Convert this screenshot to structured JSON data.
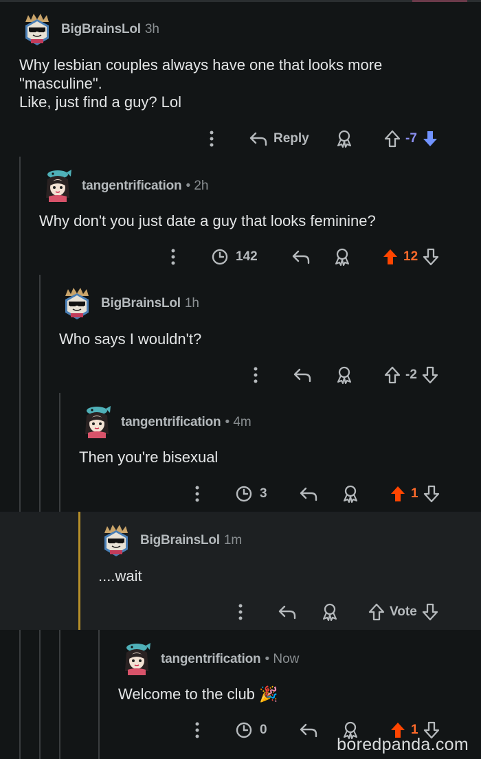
{
  "comments": [
    {
      "author": "BigBrainsLol",
      "time": "3h",
      "text": "Why lesbian couples always have one that looks more\n\"masculine\".\nLike, just find a guy? Lol",
      "reply_label": "Reply",
      "score": "-7",
      "vote": "down",
      "avatar": "sunglasses-avatar"
    },
    {
      "author": "tangentrification",
      "time": "• 2h",
      "text": "Why don't you just date a guy that looks feminine?",
      "awards": "142",
      "score": "12",
      "vote": "up",
      "avatar": "fish-hat-avatar"
    },
    {
      "author": "BigBrainsLol",
      "time": "1h",
      "text": "Who says I wouldn't?",
      "score": "-2",
      "vote": "none",
      "avatar": "sunglasses-avatar"
    },
    {
      "author": "tangentrification",
      "time": "• 4m",
      "text": "Then you're bisexual",
      "awards": "3",
      "score": "1",
      "vote": "up",
      "avatar": "fish-hat-avatar"
    },
    {
      "author": "BigBrainsLol",
      "time": "1m",
      "text": "....wait",
      "score": "Vote",
      "vote": "none",
      "avatar": "sunglasses-avatar"
    },
    {
      "author": "tangentrification",
      "time": "• Now",
      "text": "Welcome to the club 🎉",
      "awards": "0",
      "score": "1",
      "vote": "up",
      "avatar": "fish-hat-avatar"
    }
  ],
  "colors": {
    "upvoted": "#ff4500",
    "downvoted": "#7193ff",
    "thread_line": "#3a3d3f",
    "highlight_bar": "#b58e2a"
  },
  "watermark": "boredpanda.com"
}
